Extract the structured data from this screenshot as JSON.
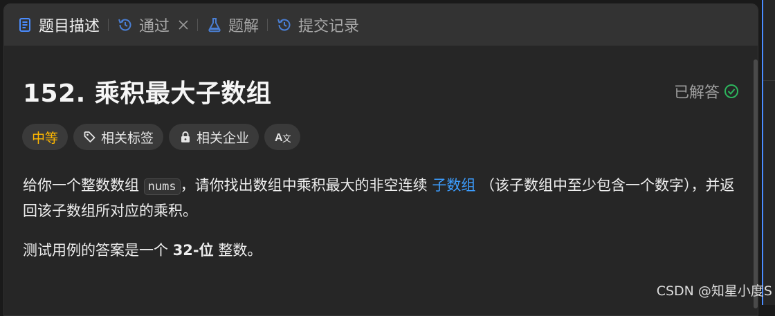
{
  "tabs": [
    {
      "label": "题目描述",
      "icon": "document-icon",
      "active": true
    },
    {
      "label": "通过",
      "icon": "history-icon",
      "active": false,
      "closable": true
    },
    {
      "label": "题解",
      "icon": "flask-icon",
      "active": false
    },
    {
      "label": "提交记录",
      "icon": "history-icon",
      "active": false
    }
  ],
  "problem": {
    "title": "152. 乘积最大子数组",
    "status": "已解答",
    "tags": {
      "difficulty": "中等",
      "related_topics": "相关标签",
      "related_companies": "相关企业",
      "translate": "A文"
    },
    "description": {
      "p1_a": "给你一个整数数组",
      "p1_code": "nums",
      "p1_b": "，请你找出数组中乘积最大的非空连续",
      "p1_link": "子数组",
      "p1_c": "（该子数组中至少包含一个数字），并返回该子数组所对应的乘积。",
      "p2_a": "测试用例的答案是一个",
      "p2_bold": "32-位",
      "p2_b": "整数。"
    }
  },
  "watermark": "CSDN @知星小度S",
  "colors": {
    "difficulty": "#ffb800",
    "link": "#3c9dff",
    "solved_check": "#2db55d",
    "tab_icon_active": "#4a8cff"
  }
}
